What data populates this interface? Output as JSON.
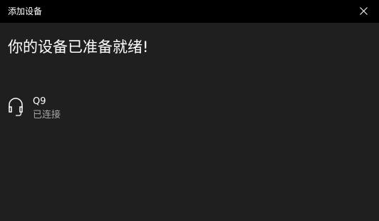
{
  "window": {
    "title": "添加设备",
    "close_icon": "close-icon"
  },
  "main": {
    "heading": "你的设备已准备就绪!",
    "device": {
      "icon": "headset-icon",
      "name": "Q9",
      "status": "已连接"
    }
  },
  "colors": {
    "titlebar_bg": "#000000",
    "window_bg": "#1f1f1f",
    "text_primary": "#ffffff",
    "text_secondary": "#a6a6a6"
  }
}
